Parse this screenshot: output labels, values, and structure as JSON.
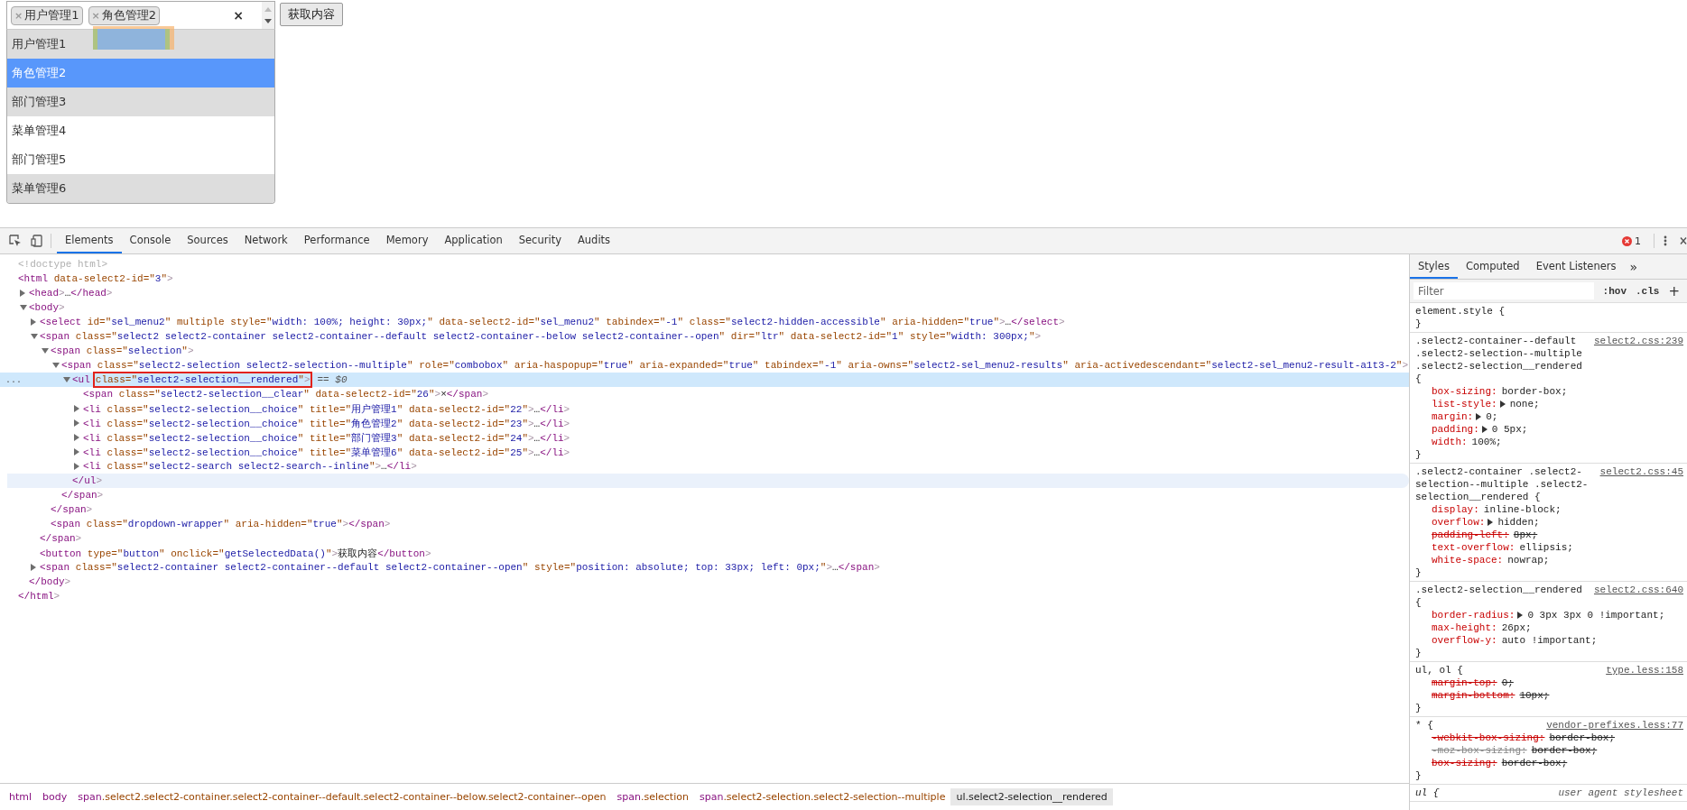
{
  "page": {
    "select": {
      "chips": [
        {
          "remove": "×",
          "label": "用户管理1"
        },
        {
          "remove": "×",
          "label": "角色管理2"
        }
      ],
      "clear": "×",
      "options": [
        {
          "label": "用户管理1",
          "chosen": true,
          "highlighted": false
        },
        {
          "label": "角色管理2",
          "chosen": true,
          "highlighted": true
        },
        {
          "label": "部门管理3",
          "chosen": true,
          "highlighted": false
        },
        {
          "label": "菜单管理4",
          "chosen": false,
          "highlighted": false
        },
        {
          "label": "部门管理5",
          "chosen": false,
          "highlighted": false
        },
        {
          "label": "菜单管理6",
          "chosen": true,
          "highlighted": false
        }
      ]
    },
    "button": "获取内容"
  },
  "devtools": {
    "tabs": [
      {
        "label": "Elements",
        "selected": true
      },
      {
        "label": "Console",
        "selected": false
      },
      {
        "label": "Sources",
        "selected": false
      },
      {
        "label": "Network",
        "selected": false
      },
      {
        "label": "Performance",
        "selected": false
      },
      {
        "label": "Memory",
        "selected": false
      },
      {
        "label": "Application",
        "selected": false
      },
      {
        "label": "Security",
        "selected": false
      },
      {
        "label": "Audits",
        "selected": false
      }
    ],
    "error_count": "1",
    "elements": {
      "tree": [
        {
          "line": "<!doctype html>",
          "selected": false
        },
        {
          "line": "<html data-select2-id=\"3\">",
          "selected": false,
          "close": "</html>",
          "children": [
            {
              "line": "<head>…</head>",
              "expanded": false,
              "selected": false
            },
            {
              "line": "<body>",
              "expanded": true,
              "selected": false,
              "close": "</body>",
              "children": [
                {
                  "line": "<select id=\"sel_menu2\" multiple style=\"width: 100%; height: 30px;\" data-select2-id=\"sel_menu2\" tabindex=\"-1\" class=\"select2-hidden-accessible\" aria-hidden=\"true\">…</select>",
                  "expanded": false,
                  "selected": false
                },
                {
                  "line": "<span class=\"select2 select2-container select2-container--default select2-container--below select2-container--open\" dir=\"ltr\" data-select2-id=\"1\" style=\"width: 300px;\">",
                  "expanded": true,
                  "selected": false,
                  "close": "</span>",
                  "children": [
                    {
                      "line": "<span class=\"selection\">",
                      "expanded": true,
                      "selected": false,
                      "close": "</span>",
                      "children": [
                        {
                          "line": "<span class=\"select2-selection select2-selection--multiple\" role=\"combobox\" aria-haspopup=\"true\" aria-expanded=\"true\" tabindex=\"-1\" aria-owns=\"select2-sel_menu2-results\" aria-activedescendant=\"select2-sel_menu2-result-a1t3-2\">",
                          "expanded": true,
                          "selected": false,
                          "close": "</span>",
                          "children": [
                            {
                              "line": "<ul",
                              "boxed": "class=\"select2-selection__rendered\">",
                              "marker": "== $0",
                              "gutter": "...",
                              "expanded": true,
                              "selected": true,
                              "close": "</ul>",
                              "close_hovered": true,
                              "children": [
                                {
                                  "line": "<span class=\"select2-selection__clear\" data-select2-id=\"26\">×</span>",
                                  "selected": false
                                },
                                {
                                  "line": "<li class=\"select2-selection__choice\" title=\"用户管理1\" data-select2-id=\"22\">…</li>",
                                  "expanded": false,
                                  "selected": false
                                },
                                {
                                  "line": "<li class=\"select2-selection__choice\" title=\"角色管理2\" data-select2-id=\"23\">…</li>",
                                  "expanded": false,
                                  "selected": false
                                },
                                {
                                  "line": "<li class=\"select2-selection__choice\" title=\"部门管理3\" data-select2-id=\"24\">…</li>",
                                  "expanded": false,
                                  "selected": false
                                },
                                {
                                  "line": "<li class=\"select2-selection__choice\" title=\"菜单管理6\" data-select2-id=\"25\">…</li>",
                                  "expanded": false,
                                  "selected": false
                                },
                                {
                                  "line": "<li class=\"select2-search select2-search--inline\">…</li>",
                                  "expanded": false,
                                  "selected": false
                                }
                              ]
                            }
                          ]
                        }
                      ]
                    },
                    {
                      "line": "<span class=\"dropdown-wrapper\" aria-hidden=\"true\"></span>",
                      "selected": false
                    }
                  ]
                },
                {
                  "line": "<button type=\"button\" onclick=\"getSelectedData()\">获取内容</button>",
                  "selected": false
                },
                {
                  "line": "<span class=\"select2-container select2-container--default select2-container--open\" style=\"position: absolute; top: 33px; left: 0px;\">…</span>",
                  "expanded": false,
                  "selected": false
                }
              ]
            }
          ]
        }
      ]
    },
    "breadcrumbs": [
      {
        "label": "html",
        "selected": false
      },
      {
        "label": "body",
        "selected": false
      },
      {
        "label": "span.select2.select2-container.select2-container--default.select2-container--below.select2-container--open",
        "selected": false
      },
      {
        "label": "span.selection",
        "selected": false
      },
      {
        "label": "span.select2-selection.select2-selection--multiple",
        "selected": false
      },
      {
        "label": "ul.select2-selection__rendered",
        "selected": true
      }
    ],
    "styles": {
      "tabs": [
        {
          "label": "Styles",
          "selected": true
        },
        {
          "label": "Computed",
          "selected": false
        },
        {
          "label": "Event Listeners",
          "selected": false
        }
      ],
      "more": "»",
      "filter_placeholder": "Filter",
      "hov": ":hov",
      "cls": ".cls",
      "add": "+",
      "rules": [
        {
          "selector": "element.style {",
          "close": "}"
        },
        {
          "selector": ".select2-container--default .select2-selection--multiple .select2-selection__rendered {",
          "source": "select2.css:239",
          "close": "}",
          "properties": [
            {
              "name": "box-sizing:",
              "value": "border-box;",
              "expandable": false,
              "struck": false
            },
            {
              "name": "list-style:",
              "value": "none;",
              "expandable": true,
              "struck": false
            },
            {
              "name": "margin:",
              "value": "0;",
              "expandable": true,
              "struck": false
            },
            {
              "name": "padding:",
              "value": "0 5px;",
              "expandable": true,
              "struck": false
            },
            {
              "name": "width:",
              "value": "100%;",
              "expandable": false,
              "struck": false
            }
          ]
        },
        {
          "selector": ".select2-container .select2-selection--multiple .select2-selection__rendered {",
          "source": "select2.css:45",
          "close": "}",
          "properties": [
            {
              "name": "display:",
              "value": "inline-block;",
              "expandable": false,
              "struck": false
            },
            {
              "name": "overflow:",
              "value": "hidden;",
              "expandable": true,
              "struck": false
            },
            {
              "name": "padding-left:",
              "value": "8px;",
              "expandable": false,
              "struck": true
            },
            {
              "name": "text-overflow:",
              "value": "ellipsis;",
              "expandable": false,
              "struck": false
            },
            {
              "name": "white-space:",
              "value": "nowrap;",
              "expandable": false,
              "struck": false
            }
          ]
        },
        {
          "selector": ".select2-selection__rendered {",
          "source": "select2.css:640",
          "close": "}",
          "properties": [
            {
              "name": "border-radius:",
              "value": "0 3px 3px 0 !important;",
              "expandable": true,
              "struck": false
            },
            {
              "name": "max-height:",
              "value": "26px;",
              "expandable": false,
              "struck": false
            },
            {
              "name": "overflow-y:",
              "value": "auto !important;",
              "expandable": false,
              "struck": false
            }
          ]
        },
        {
          "selector": "ul, ol {",
          "source": "type.less:158",
          "close": "}",
          "properties": [
            {
              "name": "margin-top:",
              "value": "0;",
              "expandable": false,
              "struck": true
            },
            {
              "name": "margin-bottom:",
              "value": "10px;",
              "expandable": false,
              "struck": true
            }
          ]
        },
        {
          "selector": "* {",
          "source": "vendor-prefixes.less:77",
          "close": "}",
          "properties": [
            {
              "name": "-webkit-box-sizing:",
              "value": "border-box;",
              "expandable": false,
              "struck": true,
              "invalid": false
            },
            {
              "name": "-moz-box-sizing:",
              "value": "border-box;",
              "expandable": false,
              "struck": true,
              "invalid": true
            },
            {
              "name": "box-sizing:",
              "value": "border-box;",
              "expandable": false,
              "struck": true,
              "invalid": false
            }
          ]
        },
        {
          "selector": "ul {",
          "source": "user agent stylesheet",
          "user_agent": true
        }
      ]
    }
  }
}
